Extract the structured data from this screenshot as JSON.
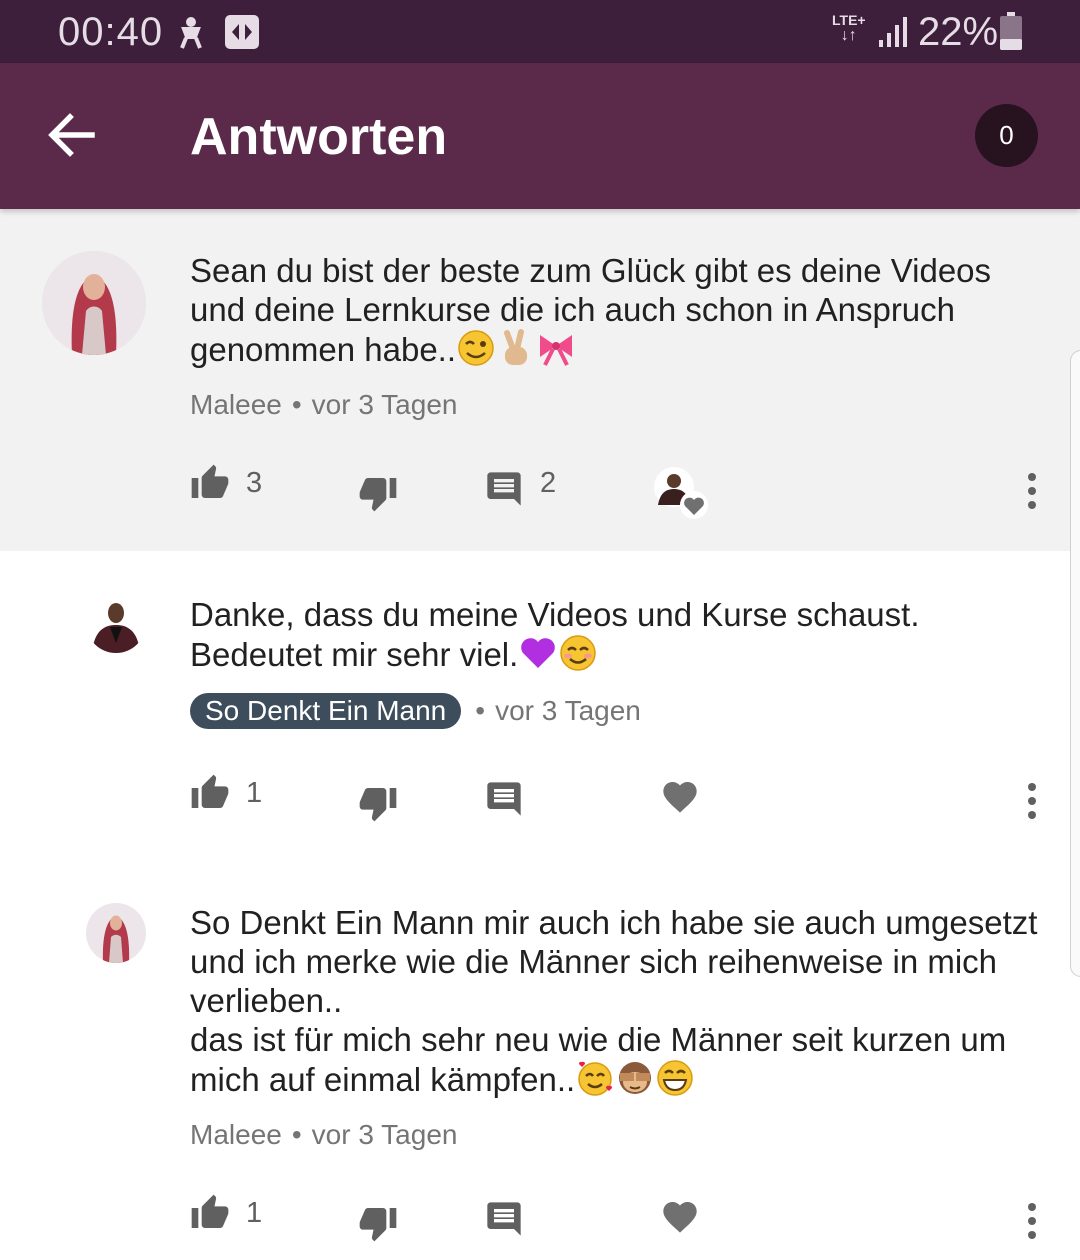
{
  "status": {
    "time": "00:40",
    "network": "LTE+",
    "battery": "22%"
  },
  "appbar": {
    "title": "Antworten",
    "count": "0"
  },
  "comments": [
    {
      "text": "Sean du bist der beste zum Glück gibt es deine Videos und deine Lernkurse die ich auch schon in Anspruch genommen habe..",
      "author": "Maleee",
      "time": "vor 3 Tagen",
      "likes": "3",
      "replies": "2"
    },
    {
      "text": "Danke, dass du meine Videos und Kurse schaust. Bedeutet mir sehr viel.",
      "author": "So Denkt Ein Mann",
      "time": "vor 3 Tagen",
      "likes": "1"
    },
    {
      "text1": "So Denkt Ein Mann mir auch ich habe sie auch umgesetzt und ich merke wie die Männer sich reihenweise in mich verlieben..",
      "text2": "das ist für mich sehr neu wie die Männer seit kurzen um mich auf einmal kämpfen..",
      "author": "Maleee",
      "time": "vor 3 Tagen",
      "likes": "1"
    }
  ],
  "icons": {
    "accent": "#5b2a4b",
    "statusbar": "#3d1e3b",
    "chip": "#3e4d5c"
  }
}
